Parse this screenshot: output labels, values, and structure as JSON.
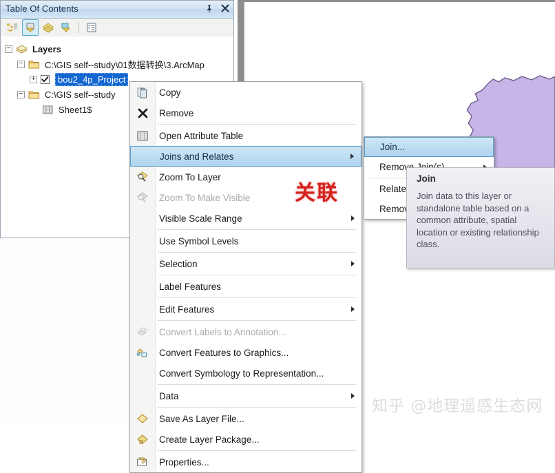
{
  "panel": {
    "title": "Table Of Contents",
    "pin_icon": "pin-icon",
    "close_icon": "close-icon",
    "toolbar": [
      {
        "name": "list-by-drawing-order",
        "tooltip": "List By Drawing Order",
        "selected": false
      },
      {
        "name": "list-by-source",
        "tooltip": "List By Source",
        "selected": true
      },
      {
        "name": "list-by-visibility",
        "tooltip": "List By Visibility",
        "selected": false
      },
      {
        "name": "list-by-selection",
        "tooltip": "List By Selection",
        "selected": false
      },
      {
        "name": "options",
        "tooltip": "Options",
        "selected": false
      }
    ]
  },
  "tree": {
    "root": "Layers",
    "folder1": "C:\\GIS  self--study\\01数据转换\\3.ArcMap",
    "layer1": "bou2_4p_Project",
    "folder2": "C:\\GIS  self--study",
    "table1": "Sheet1$"
  },
  "context_menu": {
    "items": [
      {
        "label": "Copy",
        "icon": "copy-icon",
        "disabled": false,
        "submenu": false,
        "highlighted": false,
        "sep_after": false
      },
      {
        "label": "Remove",
        "icon": "remove-x-icon",
        "disabled": false,
        "submenu": false,
        "highlighted": false,
        "sep_after": true
      },
      {
        "label": "Open Attribute Table",
        "icon": "table-icon",
        "disabled": false,
        "submenu": false,
        "highlighted": false,
        "sep_after": false
      },
      {
        "label": "Joins and Relates",
        "icon": "",
        "disabled": false,
        "submenu": true,
        "highlighted": true,
        "sep_after": false
      },
      {
        "label": "Zoom To Layer",
        "icon": "zoom-layer-icon",
        "disabled": false,
        "submenu": false,
        "highlighted": false,
        "sep_after": false
      },
      {
        "label": "Zoom To Make Visible",
        "icon": "zoom-visible-icon",
        "disabled": true,
        "submenu": false,
        "highlighted": false,
        "sep_after": false
      },
      {
        "label": "Visible Scale Range",
        "icon": "",
        "disabled": false,
        "submenu": true,
        "highlighted": false,
        "sep_after": true
      },
      {
        "label": "Use Symbol Levels",
        "icon": "",
        "disabled": false,
        "submenu": false,
        "highlighted": false,
        "sep_after": true
      },
      {
        "label": "Selection",
        "icon": "",
        "disabled": false,
        "submenu": true,
        "highlighted": false,
        "sep_after": true
      },
      {
        "label": "Label Features",
        "icon": "",
        "disabled": false,
        "submenu": false,
        "highlighted": false,
        "sep_after": true
      },
      {
        "label": "Edit Features",
        "icon": "",
        "disabled": false,
        "submenu": true,
        "highlighted": false,
        "sep_after": true
      },
      {
        "label": "Convert Labels to Annotation...",
        "icon": "convert-annotation-icon",
        "disabled": true,
        "submenu": false,
        "highlighted": false,
        "sep_after": false
      },
      {
        "label": "Convert Features to Graphics...",
        "icon": "convert-graphics-icon",
        "disabled": false,
        "submenu": false,
        "highlighted": false,
        "sep_after": false
      },
      {
        "label": "Convert Symbology to Representation...",
        "icon": "",
        "disabled": false,
        "submenu": false,
        "highlighted": false,
        "sep_after": true
      },
      {
        "label": "Data",
        "icon": "",
        "disabled": false,
        "submenu": true,
        "highlighted": false,
        "sep_after": true
      },
      {
        "label": "Save As Layer File...",
        "icon": "layer-file-icon",
        "disabled": false,
        "submenu": false,
        "highlighted": false,
        "sep_after": false
      },
      {
        "label": "Create Layer Package...",
        "icon": "layer-package-icon",
        "disabled": false,
        "submenu": false,
        "highlighted": false,
        "sep_after": true
      },
      {
        "label": "Properties...",
        "icon": "properties-icon",
        "disabled": false,
        "submenu": false,
        "highlighted": false,
        "sep_after": false
      }
    ]
  },
  "submenu": {
    "items": [
      {
        "label": "Join...",
        "submenu": false,
        "highlighted": true,
        "sep_after": false
      },
      {
        "label": "Remove Join(s)",
        "submenu": true,
        "highlighted": false,
        "sep_after": true
      },
      {
        "label": "Relate...",
        "submenu": false,
        "highlighted": false,
        "sep_after": false
      },
      {
        "label": "Remove Relate(s)",
        "submenu": true,
        "highlighted": false,
        "sep_after": false
      }
    ]
  },
  "tooltip": {
    "title": "Join",
    "body": "Join data to this layer or standalone table based on a common attribute, spatial location or existing relationship class."
  },
  "annotation": "关联",
  "watermark": "知乎 @地理遥感生态网",
  "colors": {
    "highlight_blue": "#aed4ee",
    "selection_blue": "#1267d1",
    "annotation_red": "#d3211c",
    "map_polygon_purple": "#c7b5e8",
    "map_polygon_pink": "#f6c3d8",
    "toolbar_selected": "#d5ecf7"
  }
}
